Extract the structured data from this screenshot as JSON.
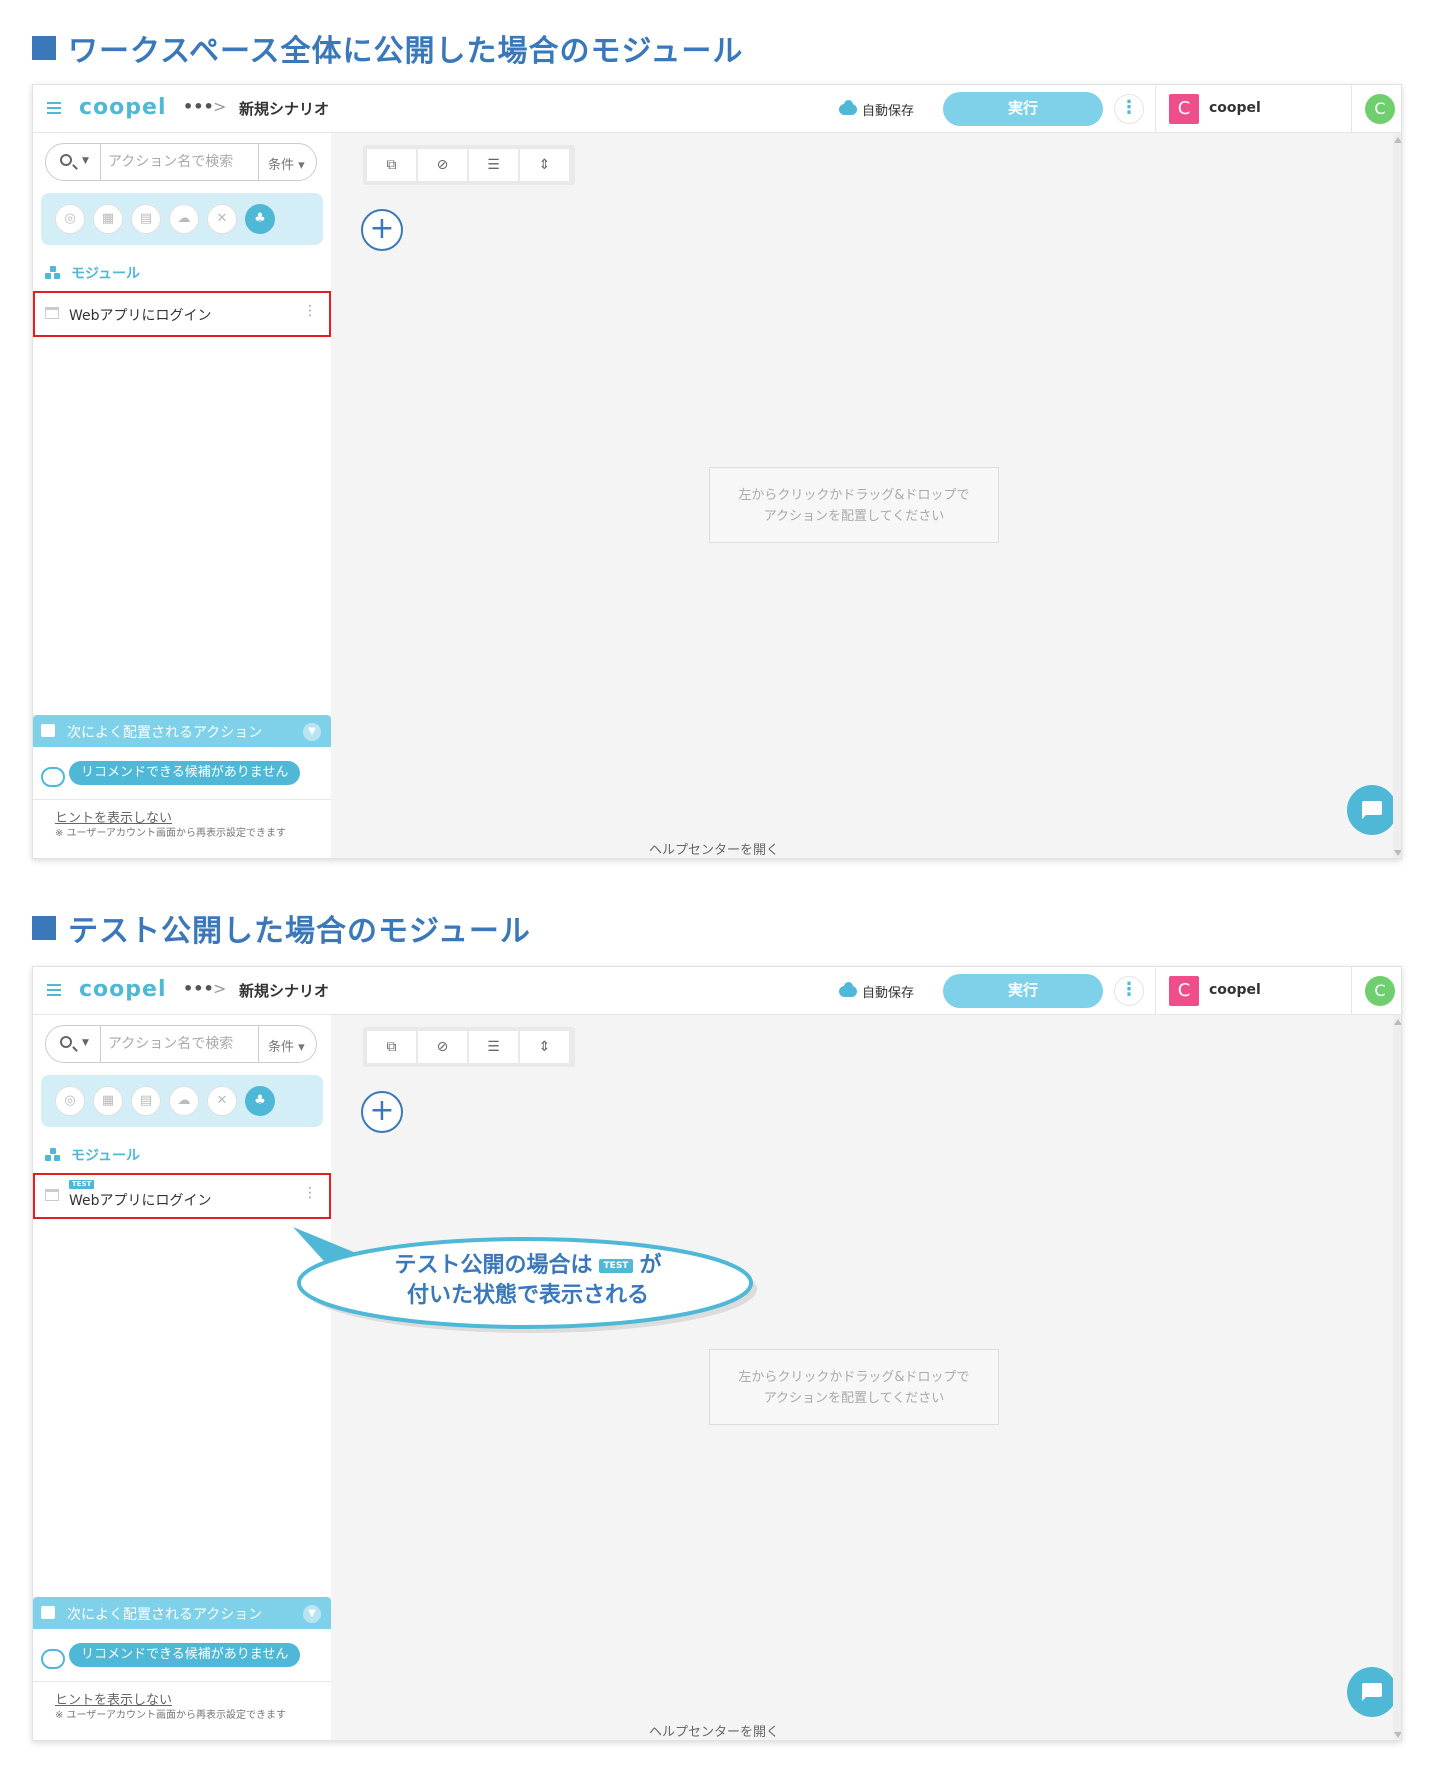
{
  "sections": [
    {
      "heading": "ワークスペース全体に公開した場合のモジュール",
      "show_test_badge": false
    },
    {
      "heading": "テスト公開した場合のモジュール",
      "show_test_badge": true
    }
  ],
  "app": {
    "logo": "coopel",
    "breadcrumb_more": "•••",
    "breadcrumb_sep": ">",
    "scenario_title": "新規シナリオ",
    "autosave_label": "自動保存",
    "run_label": "実行",
    "kebab": "⋮",
    "workspace_initial": "C",
    "workspace_name": "coopel",
    "user_initial": "C"
  },
  "sidebar": {
    "search_placeholder": "アクション名で検索",
    "condition_label": "条件 ▾",
    "categories": [
      "web-icon",
      "excel-icon",
      "document-icon",
      "cloud-icon",
      "tools-icon",
      "module-icon"
    ],
    "section_label": "モジュール",
    "module_item": "Webアプリにログイン",
    "module_kebab": "⋮",
    "test_badge": "TEST",
    "reco_header": "次によく配置されるアクション",
    "reco_empty": "リコメンドできる候補がありません",
    "hint_link": "ヒントを表示しない",
    "hint_note": "※ ユーザーアカウント画面から再表示設定できます"
  },
  "canvas": {
    "hint_line1": "左からクリックかドラッグ&ドロップで",
    "hint_line2": "アクションを配置してください",
    "help_link": "ヘルプセンターを開く"
  },
  "callout": {
    "line1_a": "テスト公開の場合は",
    "badge": "TEST",
    "line1_b": "が",
    "line2": "付いた状態で表示される"
  },
  "colors": {
    "accent": "#4fb8d6",
    "heading": "#3a78b9",
    "highlight": "#e02020",
    "workspace": "#f04e8a",
    "user": "#6fcf6f"
  }
}
